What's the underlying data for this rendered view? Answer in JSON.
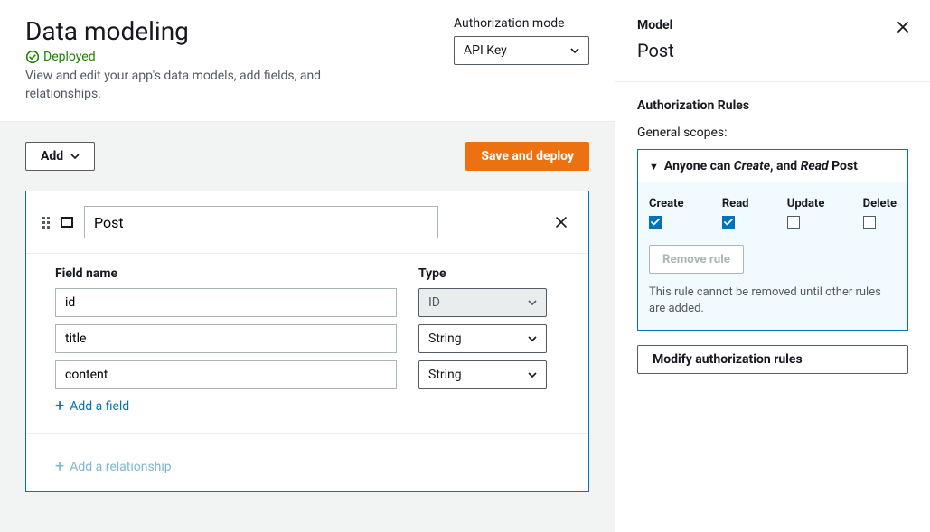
{
  "header": {
    "title": "Data modeling",
    "status": "Deployed",
    "subtitle": "View and edit your app's data models, add fields, and relationships.",
    "auth_label": "Authorization mode",
    "auth_value": "API Key"
  },
  "toolbar": {
    "add_label": "Add",
    "save_label": "Save and deploy"
  },
  "model": {
    "name": "Post",
    "field_name_header": "Field name",
    "type_header": "Type",
    "fields": [
      {
        "name": "id",
        "type": "ID",
        "locked": true
      },
      {
        "name": "title",
        "type": "String",
        "locked": false
      },
      {
        "name": "content",
        "type": "String",
        "locked": false
      }
    ],
    "add_field_label": "Add a field",
    "add_relationship_label": "Add a relationship"
  },
  "panel": {
    "label": "Model",
    "model_name": "Post",
    "section_title": "Authorization Rules",
    "general_scopes": "General scopes:",
    "rule_prefix": "Anyone can ",
    "rule_create": "Create",
    "rule_and": ", and ",
    "rule_read": "Read",
    "rule_suffix": " Post",
    "perms": {
      "create": "Create",
      "read": "Read",
      "update": "Update",
      "delete": "Delete"
    },
    "remove_label": "Remove rule",
    "note": "This rule cannot be removed until other rules are added.",
    "modify_label": "Modify authorization rules"
  }
}
